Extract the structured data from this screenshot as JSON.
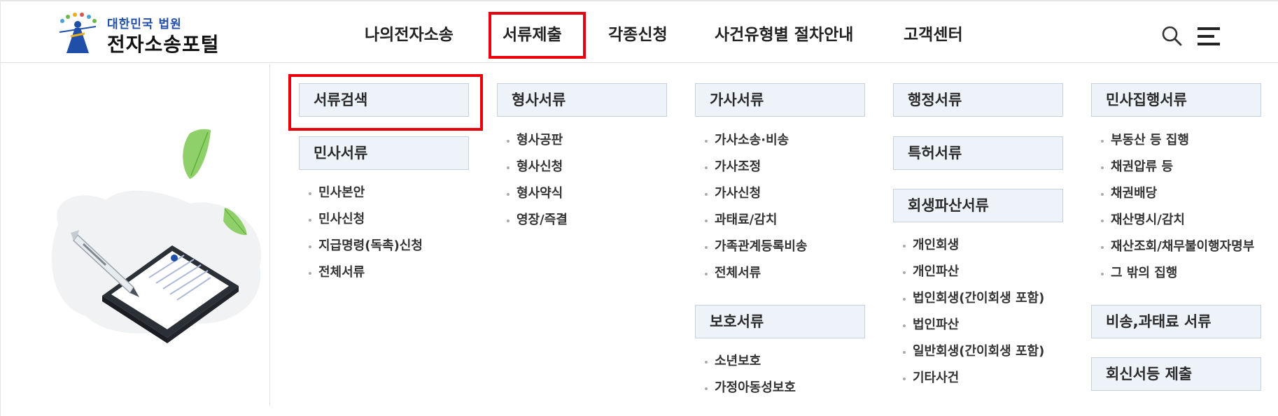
{
  "logo": {
    "subtitle": "대한민국 법원",
    "title": "전자소송포털"
  },
  "gnb": {
    "items": [
      {
        "label": "나의전자소송"
      },
      {
        "label": "서류제출"
      },
      {
        "label": "각종신청"
      },
      {
        "label": "사건유형별 절차안내"
      },
      {
        "label": "고객센터"
      }
    ]
  },
  "icons": {
    "search": "search-icon",
    "menu": "hamburger-menu-icon"
  },
  "colors": {
    "highlight": "#e8000b",
    "category_bg": "#eef3f9",
    "category_border": "#c6d1de",
    "logo_blue": "#1f4fa8"
  },
  "menu": {
    "col1": {
      "cat_search": "서류검색",
      "cat_civil": "민사서류",
      "civil_items": [
        "민사본안",
        "민사신청",
        "지급명령(독촉)신청",
        "전체서류"
      ]
    },
    "col2": {
      "cat_criminal": "형사서류",
      "criminal_items": [
        "형사공판",
        "형사신청",
        "형사약식",
        "영장/즉결"
      ]
    },
    "col3": {
      "cat_family": "가사서류",
      "family_items": [
        "가사소송·비송",
        "가사조정",
        "가사신청",
        "과태료/감치",
        "가족관계등록비송",
        "전체서류"
      ],
      "cat_protect": "보호서류",
      "protect_items": [
        "소년보호",
        "가정아동성보호"
      ]
    },
    "col4": {
      "cat_admin": "행정서류",
      "cat_patent": "특허서류",
      "cat_rehab": "회생파산서류",
      "rehab_items": [
        "개인회생",
        "개인파산",
        "법인회생(간이회생 포함)",
        "법인파산",
        "일반회생(간이회생 포함)",
        "기타사건"
      ]
    },
    "col5": {
      "cat_exec": "민사집행서류",
      "exec_items": [
        "부동산 등 집행",
        "채권압류 등",
        "채권배당",
        "재산명시/감치",
        "재산조회/채무불이행자명부",
        "그 밖의 집행"
      ],
      "cat_noncontentious": "비송,과태료 서류",
      "cat_reply": "회신서등 제출"
    }
  }
}
